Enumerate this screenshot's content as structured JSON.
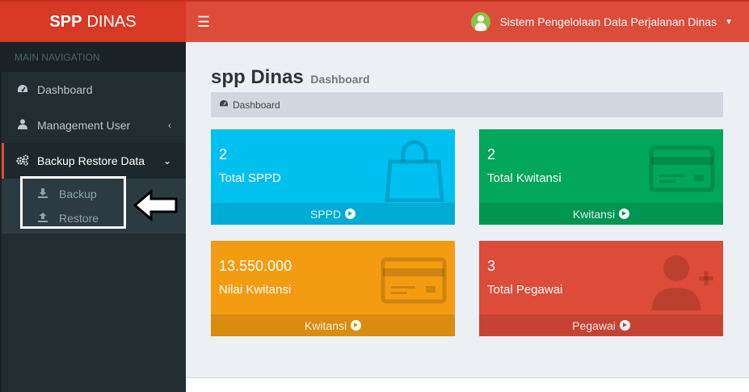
{
  "brand": {
    "bold": "SPP",
    "rest": "DINAS"
  },
  "header": {
    "menu_icon": "hamburger-icon",
    "user_name": "Sistem Pengelolaan Data Perjalanan Dinas"
  },
  "sidebar": {
    "section_header": "MAIN NAVIGATION",
    "items": [
      {
        "label": "Dashboard",
        "icon": "dashboard-icon"
      },
      {
        "label": "Management User",
        "icon": "user-icon"
      },
      {
        "label": "Backup Restore Data",
        "icon": "gears-icon"
      }
    ],
    "submenu": [
      {
        "label": "Backup",
        "icon": "download-icon"
      },
      {
        "label": "Restore",
        "icon": "upload-icon"
      }
    ]
  },
  "page": {
    "title": "spp Dinas",
    "subtitle": "Dashboard",
    "breadcrumb": "Dashboard"
  },
  "boxes": [
    {
      "value": "2",
      "label": "Total SPPD",
      "link": "SPPD",
      "color": "#00c0ef",
      "icon": "shopping-bag-icon"
    },
    {
      "value": "2",
      "label": "Total Kwitansi",
      "link": "Kwitansi",
      "color": "#00a65a",
      "icon": "credit-card-icon"
    },
    {
      "value": "13.550.000",
      "label": "Nilai Kwitansi",
      "link": "Kwitansi",
      "color": "#f39c12",
      "icon": "credit-card-icon"
    },
    {
      "value": "3",
      "label": "Total Pegawai",
      "link": "Pegawai",
      "color": "#dd4b39",
      "icon": "user-plus-icon"
    }
  ]
}
